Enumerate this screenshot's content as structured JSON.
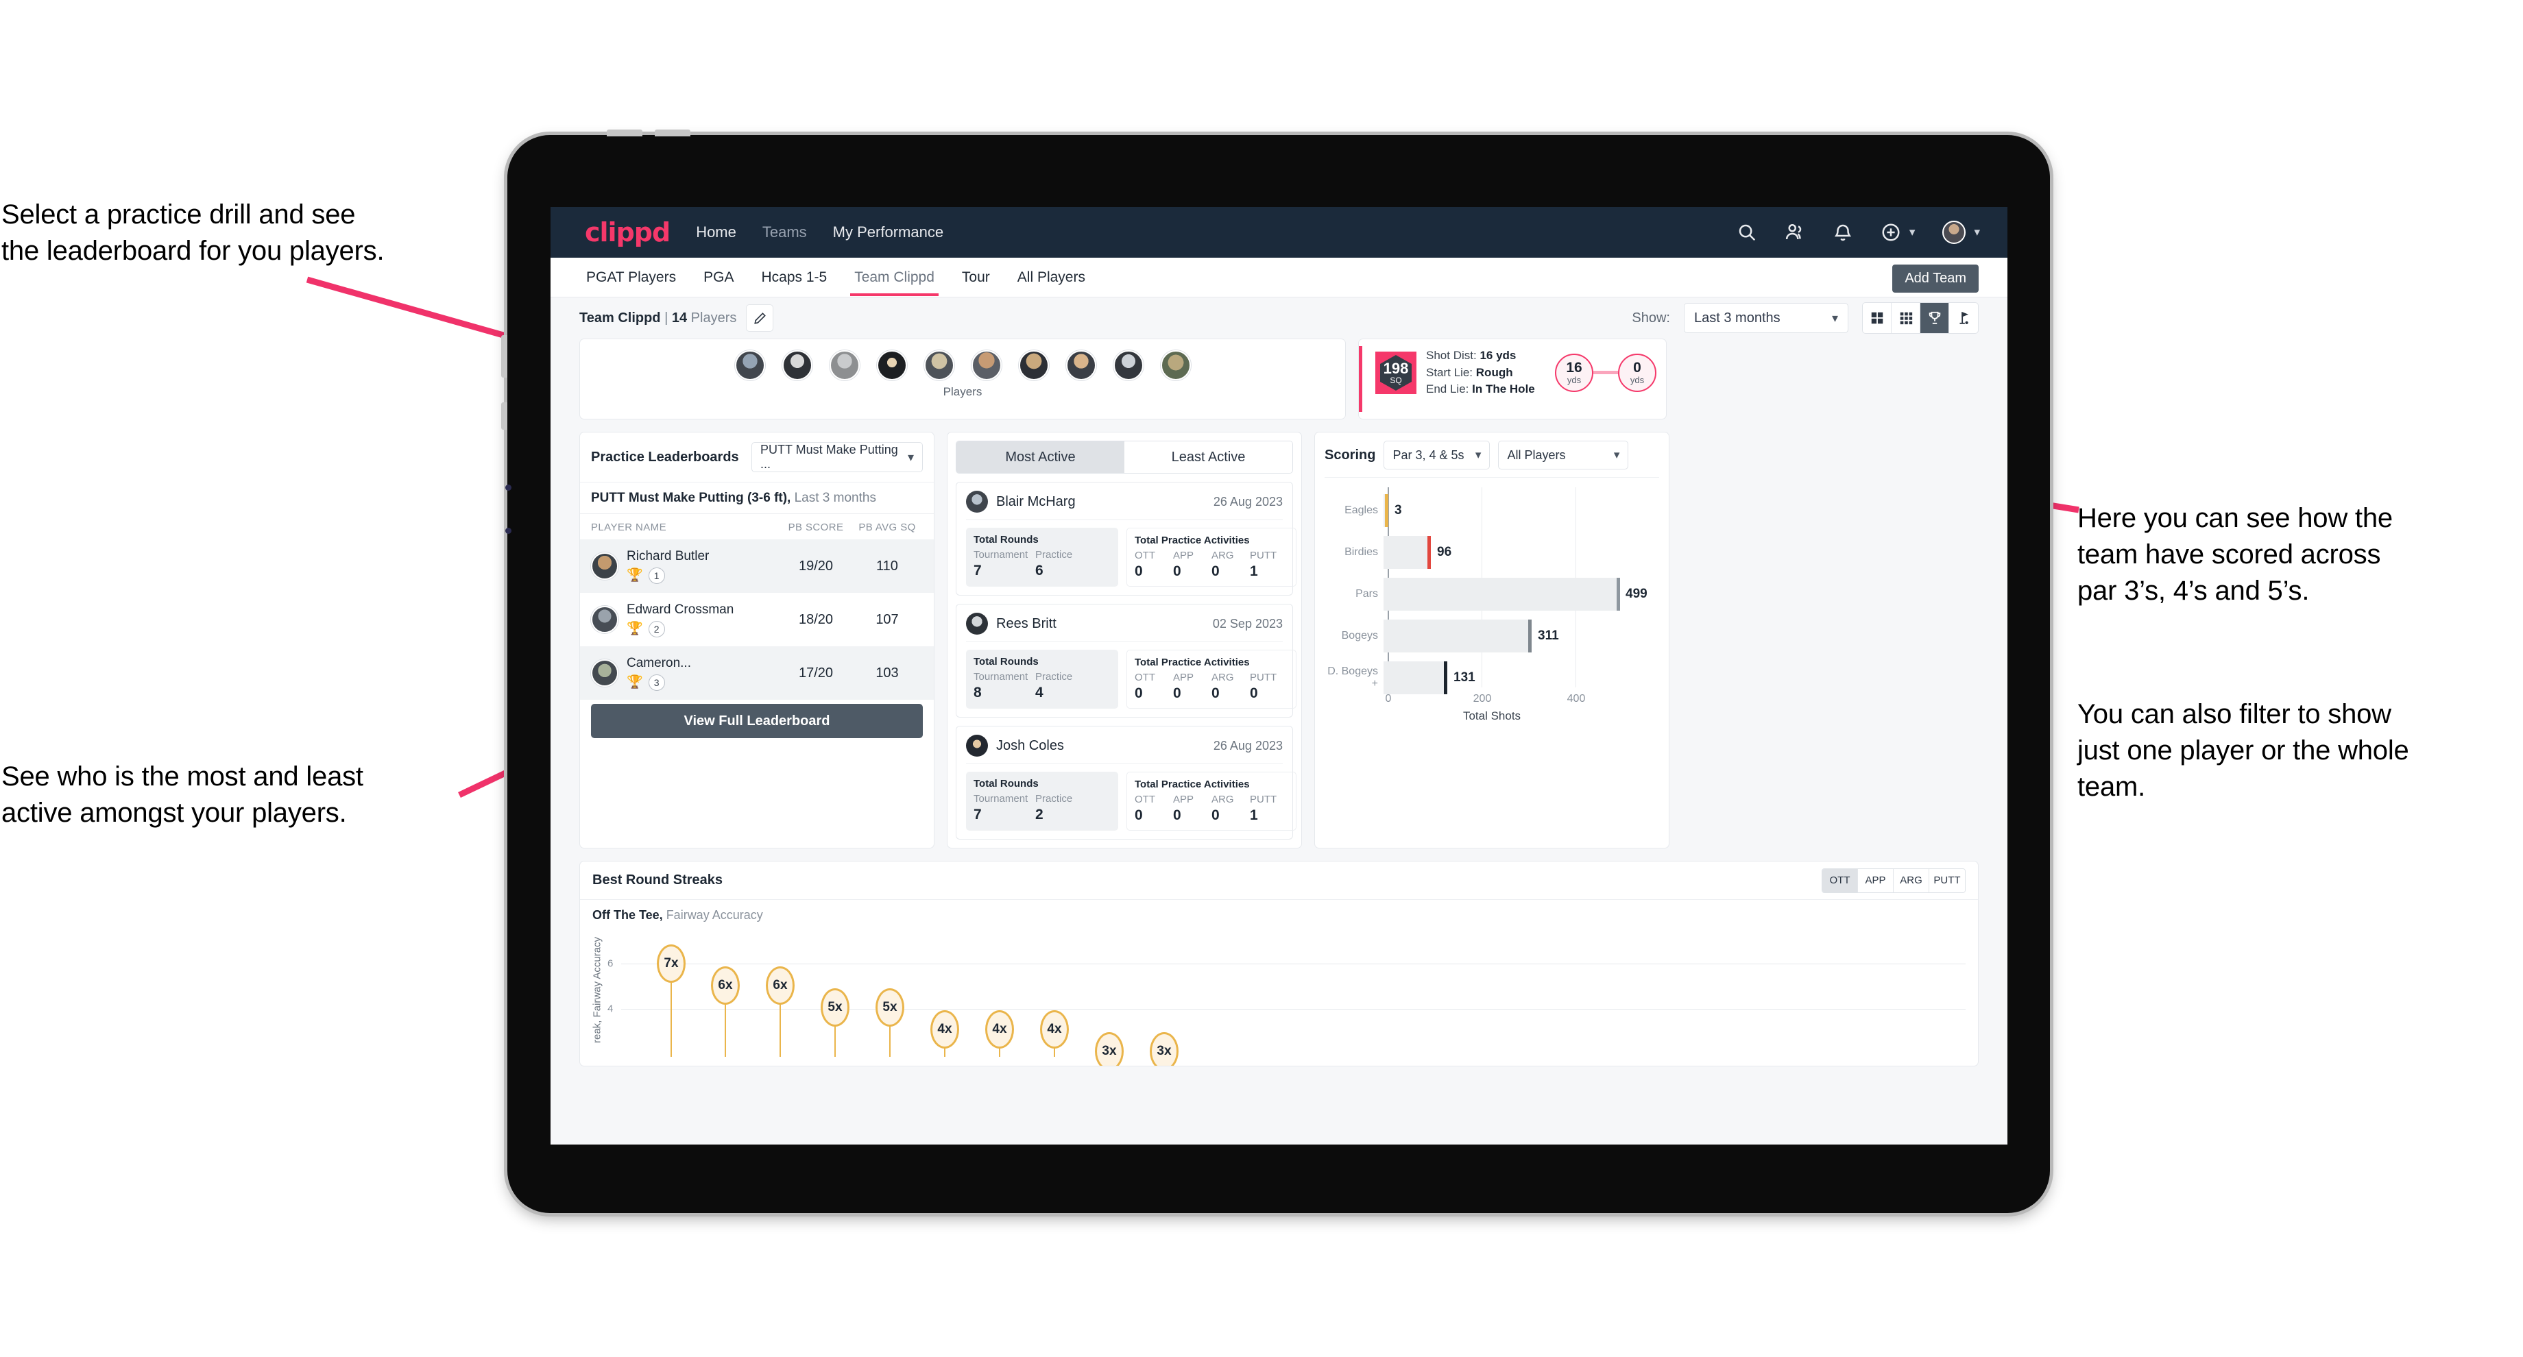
{
  "annotations": {
    "top_left": "Select a practice drill and see\nthe leaderboard for you players.",
    "bottom_left": "See who is the most and least\nactive amongst your players.",
    "right_1": "Here you can see how the\nteam have scored across\npar 3’s, 4’s and 5’s.",
    "right_2": "You can also filter to show\njust one player or the whole\nteam."
  },
  "navbar": {
    "logo": "clippd",
    "links": [
      {
        "label": "Home",
        "active": true
      },
      {
        "label": "Teams",
        "active": false
      },
      {
        "label": "My Performance",
        "active": true
      }
    ],
    "icons": [
      "search-icon",
      "people-icon",
      "bell-icon",
      "plus-circle-icon",
      "avatar"
    ]
  },
  "tabs": {
    "items": [
      "PGAT Players",
      "PGA",
      "Hcaps 1-5",
      "Team Clippd",
      "Tour",
      "All Players"
    ],
    "active": "Team Clippd",
    "add_team_label": "Add Team"
  },
  "subbar": {
    "team_name": "Team Clippd",
    "separator": "|",
    "player_count": "14",
    "players_word": "Players",
    "edit_icon": "pencil-icon",
    "show_label": "Show:",
    "show_value": "Last 3 months",
    "view_modes": [
      "grid-large-icon",
      "grid-small-icon",
      "trophy-icon",
      "flag-icon"
    ],
    "view_active": "trophy-icon"
  },
  "players_card": {
    "caption": "Players",
    "avatar_count": 10
  },
  "shot_card": {
    "badge_value": "198",
    "badge_unit": "SQ",
    "lines": [
      {
        "label": "Shot Dist:",
        "value": "16 yds"
      },
      {
        "label": "Start Lie:",
        "value": "Rough"
      },
      {
        "label": "End Lie:",
        "value": "In The Hole"
      }
    ],
    "start_dot": {
      "value": "16",
      "unit": "yds"
    },
    "end_dot": {
      "value": "0",
      "unit": "yds"
    }
  },
  "leaderboard": {
    "title": "Practice Leaderboards",
    "drill_select": "PUTT Must Make Putting ...",
    "subtitle_bold": "PUTT Must Make Putting (3-6 ft),",
    "subtitle_rest": " Last 3 months",
    "columns": [
      "PLAYER NAME",
      "PB SCORE",
      "PB AVG SQ"
    ],
    "rows": [
      {
        "name": "Richard Butler",
        "rank": "1",
        "trophy": "gold",
        "pb_score": "19/20",
        "pb_avg_sq": "110"
      },
      {
        "name": "Edward Crossman",
        "rank": "2",
        "trophy": "silver",
        "pb_score": "18/20",
        "pb_avg_sq": "107"
      },
      {
        "name": "Cameron...",
        "rank": "3",
        "trophy": "bronze",
        "pb_score": "17/20",
        "pb_avg_sq": "103"
      }
    ],
    "button_label": "View Full Leaderboard"
  },
  "activity": {
    "tabs": [
      "Most Active",
      "Least Active"
    ],
    "active_tab": "Most Active",
    "rounds_title": "Total Rounds",
    "rounds_cols": [
      "Tournament",
      "Practice"
    ],
    "practice_title": "Total Practice Activities",
    "practice_cols": [
      "OTT",
      "APP",
      "ARG",
      "PUTT"
    ],
    "items": [
      {
        "name": "Blair McHarg",
        "date": "26 Aug 2023",
        "rounds": [
          "7",
          "6"
        ],
        "practice": [
          "0",
          "0",
          "0",
          "1"
        ]
      },
      {
        "name": "Rees Britt",
        "date": "02 Sep 2023",
        "rounds": [
          "8",
          "4"
        ],
        "practice": [
          "0",
          "0",
          "0",
          "0"
        ]
      },
      {
        "name": "Josh Coles",
        "date": "26 Aug 2023",
        "rounds": [
          "7",
          "2"
        ],
        "practice": [
          "0",
          "0",
          "0",
          "1"
        ]
      }
    ]
  },
  "scoring": {
    "title": "Scoring",
    "par_select": "Par 3, 4 & 5s",
    "player_select": "All Players"
  },
  "streaks": {
    "title": "Best Round Streaks",
    "tabs": [
      "OTT",
      "APP",
      "ARG",
      "PUTT"
    ],
    "active_tab": "OTT",
    "subtitle_bold": "Off The Tee,",
    "subtitle_rest": " Fairway Accuracy",
    "y_axis_label": "reak, Fairway Accuracy",
    "y_ticks": [
      "6",
      "4"
    ]
  },
  "chart_data": [
    {
      "type": "bar",
      "orientation": "horizontal",
      "title": "Scoring",
      "categories": [
        "Eagles",
        "Birdies",
        "Pars",
        "Bogeys",
        "D. Bogeys +"
      ],
      "values": [
        3,
        96,
        499,
        311,
        131
      ],
      "tip_colors": [
        "#eab54b",
        "#e2473f",
        "#8e979f",
        "#7f878e",
        "#1c242d"
      ],
      "xlabel": "Total Shots",
      "ylabel": "",
      "xlim": [
        0,
        560
      ],
      "xticks": [
        0,
        200,
        400
      ],
      "grid": true,
      "legend": "none"
    },
    {
      "type": "scatter",
      "title": "Best Round Streaks — Off The Tee, Fairway Accuracy",
      "ylabel": "reak, Fairway Accuracy",
      "xlabel": "",
      "ylim": [
        0,
        8
      ],
      "yticks": [
        4,
        6
      ],
      "grid": true,
      "legend": "none",
      "points": [
        {
          "label": "7x",
          "value": 7
        },
        {
          "label": "6x",
          "value": 6
        },
        {
          "label": "6x",
          "value": 6
        },
        {
          "label": "5x",
          "value": 5
        },
        {
          "label": "5x",
          "value": 5
        },
        {
          "label": "4x",
          "value": 4
        },
        {
          "label": "4x",
          "value": 4
        },
        {
          "label": "4x",
          "value": 4
        },
        {
          "label": "3x",
          "value": 3
        },
        {
          "label": "3x",
          "value": 3
        }
      ]
    }
  ]
}
